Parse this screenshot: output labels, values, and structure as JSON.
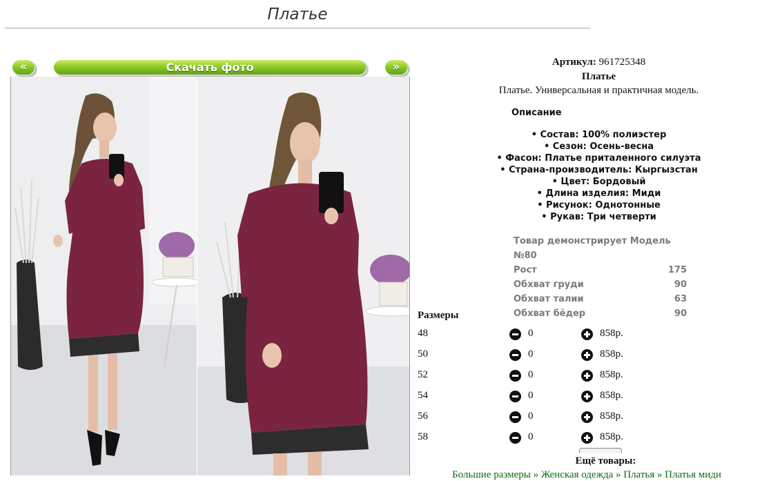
{
  "page": {
    "title": "Платье"
  },
  "nav": {
    "prev": "«",
    "download": "Скачать фото",
    "next": "»"
  },
  "product": {
    "article_label": "Артикул:",
    "article_value": "961725348",
    "name": "Платье",
    "summary": "Платье. Универсальная и практичная модель.",
    "description_heading": "Описание",
    "attributes": [
      "• Состав: 100% полиэстер",
      "• Сезон: Осень-весна",
      "• Фасон: Платье приталенного силуэта",
      "• Страна-производитель: Кыргызстан",
      "• Цвет: Бордовый",
      "• Длина изделия: Миди",
      "• Рисунок: Однотонные",
      "• Рукав: Три четверти"
    ]
  },
  "model": {
    "heading": "Товар демонстрирует Модель №80",
    "rows": [
      {
        "label": "Рост",
        "value": "175"
      },
      {
        "label": "Обхват груди",
        "value": "90"
      },
      {
        "label": "Обхват талии",
        "value": "63"
      },
      {
        "label": "Обхват бёдер",
        "value": "90"
      }
    ]
  },
  "sizes": {
    "heading": "Размеры",
    "rows": [
      {
        "size": "48",
        "qty": "0",
        "price": "858р."
      },
      {
        "size": "50",
        "qty": "0",
        "price": "858р."
      },
      {
        "size": "52",
        "qty": "0",
        "price": "858р."
      },
      {
        "size": "54",
        "qty": "0",
        "price": "858р."
      },
      {
        "size": "56",
        "qty": "0",
        "price": "858р."
      },
      {
        "size": "58",
        "qty": "0",
        "price": "858р."
      }
    ]
  },
  "more": {
    "heading": "Ещё товары:",
    "breadcrumbs": [
      "Большие размеры",
      "Женская одежда",
      "Платья",
      "Платья миди"
    ],
    "separator": " » "
  },
  "colors": {
    "dress": "#7a2440",
    "accent_green": "#8ecc26",
    "link_green": "#0b6b0b"
  }
}
